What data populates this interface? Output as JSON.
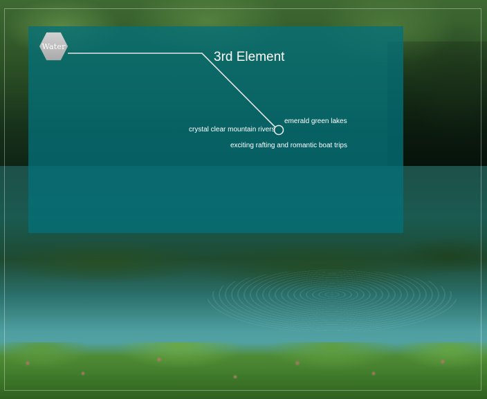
{
  "badge": {
    "label": "Water"
  },
  "heading": {
    "title": "3rd Element"
  },
  "features": [
    {
      "text": "crystal clear mountain rivers"
    },
    {
      "text": "emerald green lakes"
    },
    {
      "text": "exciting rafting and romantic boat trips"
    }
  ],
  "colors": {
    "panel": "#04707a",
    "badge": "#bdbdbd",
    "text": "#ffffff"
  },
  "icons": {
    "badge_shape": "hexagon-icon",
    "pointer": "circle-pointer-icon"
  }
}
